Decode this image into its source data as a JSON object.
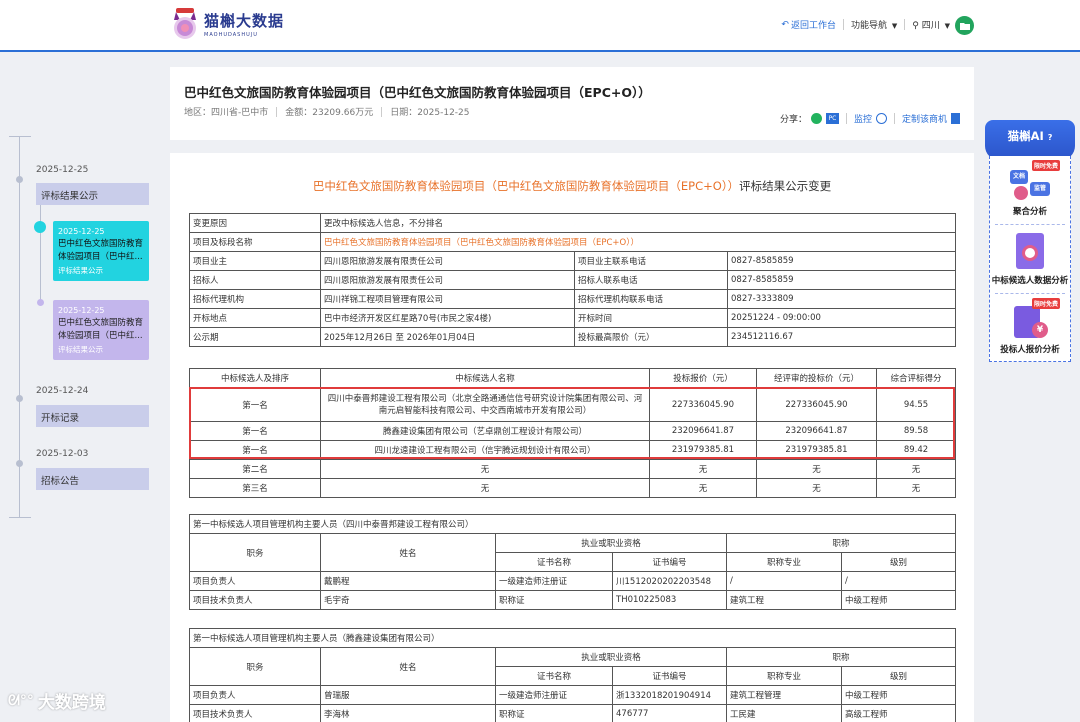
{
  "header": {
    "logo_cn": "猫槲大数据",
    "logo_en": "MAOHUDASHUJU",
    "back_label": "返回工作台",
    "nav_label": "功能导航",
    "region_label": "四川"
  },
  "project": {
    "title": "巴中红色文旅国防教育体验园项目（巴中红色文旅国防教育体验园项目（EPC+O））",
    "region": "地区：四川省-巴中市",
    "amount": "金额：23209.66万元",
    "date": "日期：2025-12-25",
    "share_label": "分享：",
    "monitor_label": "监控",
    "custom_label": "定制该商机"
  },
  "timeline": {
    "groups": [
      {
        "date": "2025-12-25",
        "stage": "评标结果公示"
      },
      {
        "date": "2025-12-24",
        "stage": "开标记录"
      },
      {
        "date": "2025-12-03",
        "stage": "招标公告"
      }
    ],
    "cards": [
      {
        "date": "2025-12-25",
        "title": "巴中红色文旅国防教育体验园项目（巴中红...",
        "type": "评标结果公示"
      },
      {
        "date": "2025-12-25",
        "title": "巴中红色文旅国防教育体验园项目（巴中红...",
        "type": "评标结果公示"
      }
    ]
  },
  "doc": {
    "title_orange": "巴中红色文旅国防教育体验园项目（巴中红色文旅国防教育体验园项目（EPC+O））",
    "title_suffix": "评标结果公示变更",
    "info": {
      "change_reason_label": "变更原因",
      "change_reason": "更改中标候选人信息，不分排名",
      "project_name_label": "项目及标段名称",
      "project_name": "巴中红色文旅国防教育体验园项目（巴中红色文旅国防教育体验园项目（EPC+O））",
      "owner_label": "项目业主",
      "owner": "四川恩阳旅游发展有限责任公司",
      "owner_phone_label": "项目业主联系电话",
      "owner_phone": "0827-8585859",
      "tenderer_label": "招标人",
      "tenderer": "四川恩阳旅游发展有限责任公司",
      "tenderer_phone_label": "招标人联系电话",
      "tenderer_phone": "0827-8585859",
      "agency_label": "招标代理机构",
      "agency": "四川祥锦工程项目管理有限公司",
      "agency_phone_label": "招标代理机构联系电话",
      "agency_phone": "0827-3333809",
      "place_label": "开标地点",
      "place": "巴中市经济开发区红星路70号(市民之家4楼)",
      "time_label": "开标时间",
      "time": "20251224 - 09:00:00",
      "period_label": "公示期",
      "period": "2025年12月26日 至 2026年01月04日",
      "max_price_label": "投标最高限价（元）",
      "max_price": "234512116.67"
    },
    "candidates": {
      "headers": [
        "中标候选人及排序",
        "中标候选人名称",
        "投标报价（元）",
        "经评审的投标价（元）",
        "综合评标得分"
      ],
      "rows": [
        {
          "rank": "第一名",
          "name": "四川中泰晋邦建设工程有限公司（北京全路通通信信号研究设计院集团有限公司、河南元启智能科技有限公司、中交西南城市开发有限公司）",
          "bid": "227336045.90",
          "evaluated": "227336045.90",
          "score": "94.55"
        },
        {
          "rank": "第一名",
          "name": "腾鑫建设集团有限公司（艺卓鼎创工程设计有限公司）",
          "bid": "232096641.87",
          "evaluated": "232096641.87",
          "score": "89.58"
        },
        {
          "rank": "第一名",
          "name": "四川龙遠建设工程有限公司（信宇腾远规划设计有限公司）",
          "bid": "231979385.81",
          "evaluated": "231979385.81",
          "score": "89.42"
        },
        {
          "rank": "第二名",
          "name": "无",
          "bid": "无",
          "evaluated": "无",
          "score": "无"
        },
        {
          "rank": "第三名",
          "name": "无",
          "bid": "无",
          "evaluated": "无",
          "score": "无"
        }
      ]
    },
    "staff1": {
      "caption": "第一中标候选人项目管理机构主要人员（四川中泰晋邦建设工程有限公司）",
      "h_role": "职务",
      "h_name": "姓名",
      "h_qual": "执业或职业资格",
      "h_title": "职称",
      "h_cert_name": "证书名称",
      "h_cert_no": "证书编号",
      "h_major": "职称专业",
      "h_level": "级别",
      "rows": [
        {
          "role": "项目负责人",
          "name": "戴鹏程",
          "cert": "一级建造师注册证",
          "no": "川1512020202203548",
          "major": "/",
          "level": "/"
        },
        {
          "role": "项目技术负责人",
          "name": "毛宇奇",
          "cert": "职称证",
          "no": "TH010225083",
          "major": "建筑工程",
          "level": "中级工程师"
        }
      ]
    },
    "staff2": {
      "caption": "第一中标候选人项目管理机构主要人员（腾鑫建设集团有限公司）",
      "h_role": "职务",
      "h_name": "姓名",
      "h_qual": "执业或职业资格",
      "h_title": "职称",
      "h_cert_name": "证书名称",
      "h_cert_no": "证书编号",
      "h_major": "职称专业",
      "h_level": "级别",
      "rows": [
        {
          "role": "项目负责人",
          "name": "曾瑞服",
          "cert": "一级建造师注册证",
          "no": "浙1332018201904914",
          "major": "建筑工程管理",
          "level": "中级工程师"
        },
        {
          "role": "项目技术负责人",
          "name": "李海林",
          "cert": "职称证",
          "no": "476777",
          "major": "工民建",
          "level": "高级工程师"
        }
      ]
    }
  },
  "ai_panel": {
    "title": "猫槲AI",
    "items": [
      {
        "label": "聚合分析",
        "badge": "限时免费"
      },
      {
        "label": "中标候选人数据分析"
      },
      {
        "label": "投标人报价分析",
        "badge": "限时免费"
      }
    ],
    "chips": [
      "文档",
      "监管"
    ]
  },
  "watermark": "大数跨境"
}
